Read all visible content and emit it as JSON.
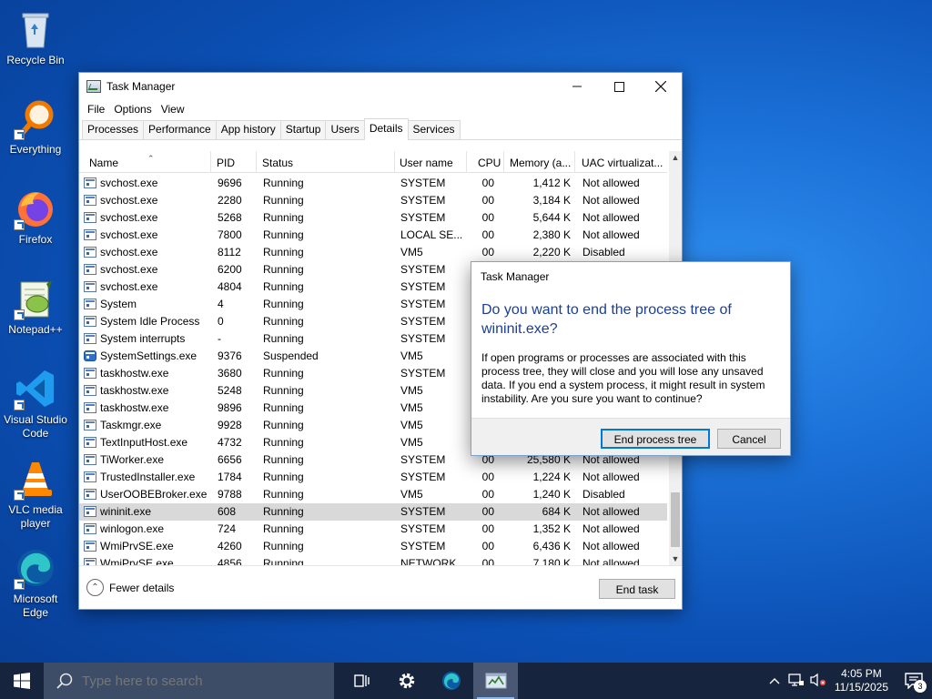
{
  "desktop": {
    "icons": [
      {
        "label": "Recycle Bin"
      },
      {
        "label": "Everything"
      },
      {
        "label": "Firefox"
      },
      {
        "label": "Notepad++"
      },
      {
        "label": "Visual Studio Code"
      },
      {
        "label": "VLC media player"
      },
      {
        "label": "Microsoft Edge"
      }
    ]
  },
  "window": {
    "title": "Task Manager",
    "minimize_icon": "minimize-icon",
    "maximize_icon": "maximize-icon",
    "close_icon": "close-icon"
  },
  "menu": [
    "File",
    "Options",
    "View"
  ],
  "tabs": [
    {
      "label": "Processes"
    },
    {
      "label": "Performance"
    },
    {
      "label": "App history"
    },
    {
      "label": "Startup"
    },
    {
      "label": "Users"
    },
    {
      "label": "Details",
      "active": true
    },
    {
      "label": "Services"
    }
  ],
  "columns": [
    "Name",
    "PID",
    "Status",
    "User name",
    "CPU",
    "Memory (a...",
    "UAC virtualizat..."
  ],
  "rows": [
    {
      "name": "svchost.exe",
      "pid": "9696",
      "status": "Running",
      "user": "SYSTEM",
      "cpu": "00",
      "memory": "1,412 K",
      "uac": "Not allowed"
    },
    {
      "name": "svchost.exe",
      "pid": "2280",
      "status": "Running",
      "user": "SYSTEM",
      "cpu": "00",
      "memory": "3,184 K",
      "uac": "Not allowed"
    },
    {
      "name": "svchost.exe",
      "pid": "5268",
      "status": "Running",
      "user": "SYSTEM",
      "cpu": "00",
      "memory": "5,644 K",
      "uac": "Not allowed"
    },
    {
      "name": "svchost.exe",
      "pid": "7800",
      "status": "Running",
      "user": "LOCAL SE...",
      "cpu": "00",
      "memory": "2,380 K",
      "uac": "Not allowed"
    },
    {
      "name": "svchost.exe",
      "pid": "8112",
      "status": "Running",
      "user": "VM5",
      "cpu": "00",
      "memory": "2,220 K",
      "uac": "Disabled"
    },
    {
      "name": "svchost.exe",
      "pid": "6200",
      "status": "Running",
      "user": "SYSTEM",
      "cpu": "",
      "memory": "",
      "uac": ""
    },
    {
      "name": "svchost.exe",
      "pid": "4804",
      "status": "Running",
      "user": "SYSTEM",
      "cpu": "",
      "memory": "",
      "uac": ""
    },
    {
      "name": "System",
      "pid": "4",
      "status": "Running",
      "user": "SYSTEM",
      "cpu": "",
      "memory": "",
      "uac": ""
    },
    {
      "name": "System Idle Process",
      "pid": "0",
      "status": "Running",
      "user": "SYSTEM",
      "cpu": "",
      "memory": "",
      "uac": ""
    },
    {
      "name": "System interrupts",
      "pid": "-",
      "status": "Running",
      "user": "SYSTEM",
      "cpu": "",
      "memory": "",
      "uac": ""
    },
    {
      "name": "SystemSettings.exe",
      "pid": "9376",
      "status": "Suspended",
      "user": "VM5",
      "cpu": "",
      "memory": "",
      "uac": "",
      "icon": "gear"
    },
    {
      "name": "taskhostw.exe",
      "pid": "3680",
      "status": "Running",
      "user": "SYSTEM",
      "cpu": "",
      "memory": "",
      "uac": ""
    },
    {
      "name": "taskhostw.exe",
      "pid": "5248",
      "status": "Running",
      "user": "VM5",
      "cpu": "",
      "memory": "",
      "uac": ""
    },
    {
      "name": "taskhostw.exe",
      "pid": "9896",
      "status": "Running",
      "user": "VM5",
      "cpu": "",
      "memory": "",
      "uac": ""
    },
    {
      "name": "Taskmgr.exe",
      "pid": "9928",
      "status": "Running",
      "user": "VM5",
      "cpu": "",
      "memory": "",
      "uac": ""
    },
    {
      "name": "TextInputHost.exe",
      "pid": "4732",
      "status": "Running",
      "user": "VM5",
      "cpu": "",
      "memory": "",
      "uac": ""
    },
    {
      "name": "TiWorker.exe",
      "pid": "6656",
      "status": "Running",
      "user": "SYSTEM",
      "cpu": "00",
      "memory": "25,580 K",
      "uac": "Not allowed"
    },
    {
      "name": "TrustedInstaller.exe",
      "pid": "1784",
      "status": "Running",
      "user": "SYSTEM",
      "cpu": "00",
      "memory": "1,224 K",
      "uac": "Not allowed"
    },
    {
      "name": "UserOOBEBroker.exe",
      "pid": "9788",
      "status": "Running",
      "user": "VM5",
      "cpu": "00",
      "memory": "1,240 K",
      "uac": "Disabled"
    },
    {
      "name": "wininit.exe",
      "pid": "608",
      "status": "Running",
      "user": "SYSTEM",
      "cpu": "00",
      "memory": "684 K",
      "uac": "Not allowed",
      "selected": true
    },
    {
      "name": "winlogon.exe",
      "pid": "724",
      "status": "Running",
      "user": "SYSTEM",
      "cpu": "00",
      "memory": "1,352 K",
      "uac": "Not allowed"
    },
    {
      "name": "WmiPrvSE.exe",
      "pid": "4260",
      "status": "Running",
      "user": "SYSTEM",
      "cpu": "00",
      "memory": "6,436 K",
      "uac": "Not allowed"
    },
    {
      "name": "WmiPrvSE.exe",
      "pid": "4856",
      "status": "Running",
      "user": "NETWORK ...",
      "cpu": "00",
      "memory": "7,180 K",
      "uac": "Not allowed"
    }
  ],
  "footer": {
    "fewer_details": "Fewer details",
    "end_task": "End task"
  },
  "dialog": {
    "title": "Task Manager",
    "heading": "Do you want to end the process tree of wininit.exe?",
    "body": "If open programs or processes are associated with this process tree, they will close and you will lose any unsaved data. If you end a system process, it might result in system instability. Are you sure you want to continue?",
    "confirm_label": "End process tree",
    "cancel_label": "Cancel"
  },
  "taskbar": {
    "search_placeholder": "Type here to search",
    "time": "4:05 PM",
    "date": "11/15/2025",
    "notification_count": "3"
  },
  "colors": {
    "accent": "#0078d7",
    "dialog_heading": "#1c3f94",
    "taskbar": "#16243d",
    "selected_row": "#d9d9d9"
  }
}
